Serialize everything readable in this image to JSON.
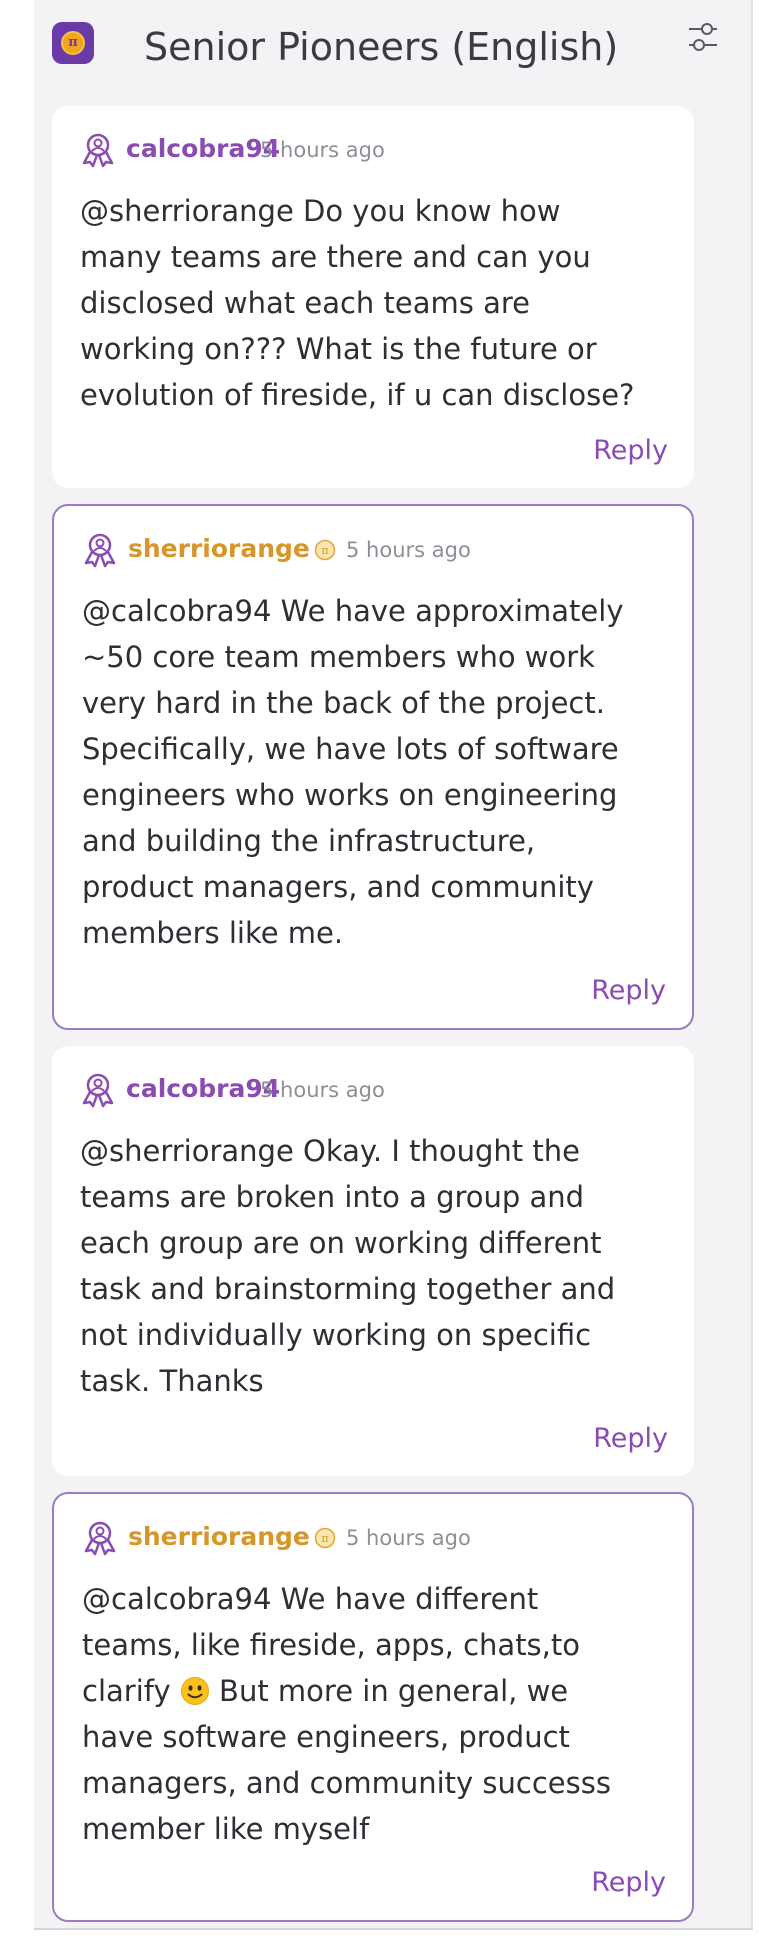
{
  "header": {
    "title": "Senior Pioneers (English)",
    "logo_glyph": "π",
    "logo_icon": "pi-app-logo",
    "filter_icon": "sliders-icon"
  },
  "colors": {
    "brand_purple": "#6b3aa8",
    "username_purple": "#8a4bb3",
    "moderator_gold": "#d6962a",
    "reply_purple": "#8a4bb3",
    "highlight_border": "#9b7cc4"
  },
  "comments": [
    {
      "username": "calcobra94",
      "user_type": "member",
      "timestamp": "5 hours ago",
      "lines": [
        "@sherriorange Do you know how",
        "many teams are there and can you",
        "disclosed what each teams are",
        "working on??? What is the future or",
        "evolution of fireside, if u can disclose?"
      ],
      "reply_label": "Reply"
    },
    {
      "username": "sherriorange",
      "user_type": "core-team",
      "timestamp": "5 hours ago",
      "lines": [
        "@calcobra94 We have approximately",
        "~50 core team members who work",
        "very hard in the back of the project.",
        "Specifically, we have lots of software",
        "engineers who works on engineering",
        "and building the infrastructure,",
        "product managers, and community",
        "members like me."
      ],
      "reply_label": "Reply"
    },
    {
      "username": "calcobra94",
      "user_type": "member",
      "timestamp": "5 hours ago",
      "lines": [
        "@sherriorange Okay. I thought the",
        "teams are broken into a group and",
        "each group are on working different",
        "task and brainstorming together and",
        "not individually working on specific",
        "task. Thanks"
      ],
      "reply_label": "Reply"
    },
    {
      "username": "sherriorange",
      "user_type": "core-team",
      "timestamp": "5 hours ago",
      "lines": [
        "@calcobra94 We have different",
        "teams, like fireside, apps, chats,to",
        "clarify",
        "have software engineers, product",
        "managers, and community successs",
        "member like myself"
      ],
      "emoji_line_suffix": " But more in general, we",
      "emoji": "slightly-smiling-face-emoji",
      "reply_label": "Reply"
    }
  ]
}
